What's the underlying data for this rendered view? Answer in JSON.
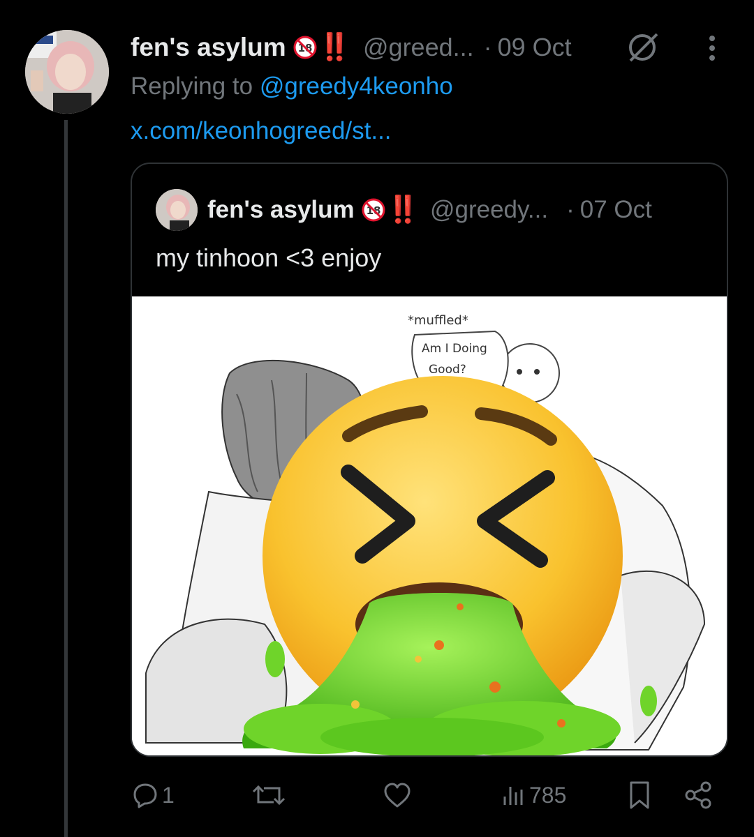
{
  "tweet": {
    "author_name": "fen's asylum",
    "badge": "18",
    "exclamation": "‼️",
    "handle": "@greed...",
    "separator": "·",
    "time": "09 Oct",
    "replying_prefix": "Replying to",
    "replying_handle": "@greedy4keonho",
    "link": "x.com/keonhogreed/st..."
  },
  "quote": {
    "author_name": "fen's asylum",
    "badge": "18",
    "exclamation": "‼️",
    "handle": "@greedy...",
    "separator": "·",
    "time": "07 Oct",
    "text": "my tinhoon <3 enjoy",
    "media": {
      "sketch_lines": [
        "*muffled*",
        "Am I Doing",
        "Good?"
      ],
      "overlay_emoji": "face-vomiting-emoji"
    }
  },
  "actions": {
    "replies": "1",
    "views": "785"
  },
  "colors": {
    "background": "#000000",
    "link_blue": "#1d9bf0",
    "muted_gray": "#71767b",
    "badge_red": "#e0142e",
    "border": "#2f3336"
  },
  "icons": [
    "grok-icon",
    "more-icon",
    "reply-icon",
    "retweet-icon",
    "like-icon",
    "views-icon",
    "bookmark-icon",
    "share-icon"
  ]
}
